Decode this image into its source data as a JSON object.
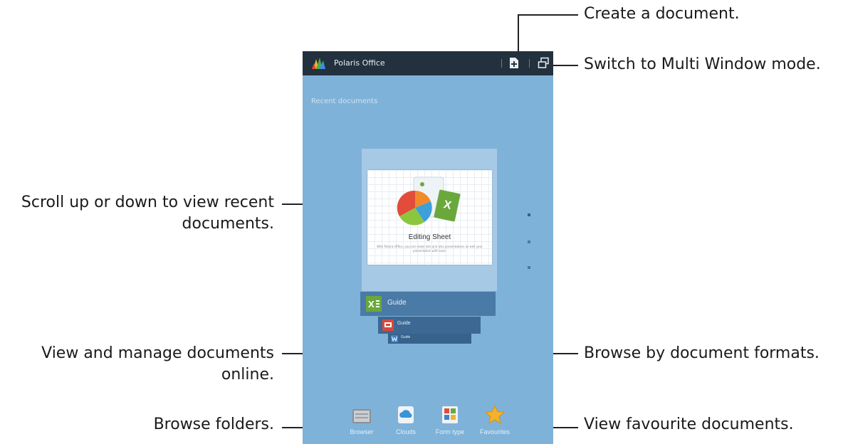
{
  "app": {
    "title": "Polaris Office"
  },
  "main": {
    "recent_title": "Recent documents"
  },
  "preview": {
    "heading": "Editing Sheet",
    "body": "With Polaris Office, you can make lists and also presentations as well your presentation with ease."
  },
  "guides": [
    {
      "label": "Guide"
    },
    {
      "label": "Guide"
    },
    {
      "label": "Guide"
    }
  ],
  "bottom_nav": [
    {
      "label": "Browser",
      "icon": "folder-icon"
    },
    {
      "label": "Clouds",
      "icon": "cloud-icon"
    },
    {
      "label": "Form type",
      "icon": "formats-icon"
    },
    {
      "label": "Favourites",
      "icon": "star-icon"
    }
  ],
  "callouts": {
    "create": "Create a document.",
    "multi_window": "Switch to Multi Window mode.",
    "scroll_line1": "Scroll up or down to view recent",
    "scroll_line2": "documents.",
    "online_line1": "View and manage documents",
    "online_line2": "online.",
    "formats": "Browse by document formats.",
    "folders": "Browse folders.",
    "favourites": "View favourite documents."
  },
  "colors": {
    "action_bar": "#22313d",
    "screen_bg": "#7fb2d8",
    "excel_green": "#6aa83c",
    "ppt_red": "#d9483b",
    "word_blue": "#3a84d1",
    "star": "#f3b22a"
  }
}
